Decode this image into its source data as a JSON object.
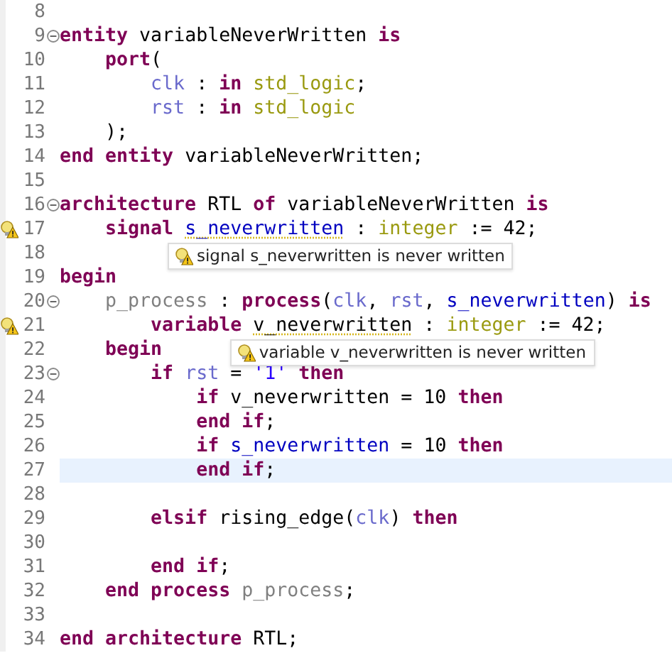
{
  "lines": [
    {
      "number": "8",
      "fold": false,
      "warning": false,
      "current": false
    },
    {
      "number": "9",
      "fold": true,
      "warning": false,
      "current": false,
      "tokens": [
        {
          "kind": "kw",
          "text": "entity"
        },
        {
          "kind": "plain",
          "text": " variableNeverWritten "
        },
        {
          "kind": "kw",
          "text": "is"
        }
      ]
    },
    {
      "number": "10",
      "fold": false,
      "warning": false,
      "current": false,
      "tokens": [
        {
          "kind": "kw",
          "text": "    port"
        },
        {
          "kind": "plain",
          "text": "("
        }
      ]
    },
    {
      "number": "11",
      "fold": false,
      "warning": false,
      "current": false,
      "tokens": [
        {
          "kind": "port",
          "text": "        clk"
        },
        {
          "kind": "plain",
          "text": " : "
        },
        {
          "kind": "kw",
          "text": "in"
        },
        {
          "kind": "type",
          "text": " std_logic"
        },
        {
          "kind": "plain",
          "text": ";"
        }
      ]
    },
    {
      "number": "12",
      "fold": false,
      "warning": false,
      "current": false,
      "tokens": [
        {
          "kind": "port",
          "text": "        rst"
        },
        {
          "kind": "plain",
          "text": " : "
        },
        {
          "kind": "kw",
          "text": "in"
        },
        {
          "kind": "type",
          "text": " std_logic"
        }
      ]
    },
    {
      "number": "13",
      "fold": false,
      "warning": false,
      "current": false,
      "tokens": [
        {
          "kind": "plain",
          "text": "    );"
        }
      ]
    },
    {
      "number": "14",
      "fold": false,
      "warning": false,
      "current": false,
      "tokens": [
        {
          "kind": "kw",
          "text": "end entity"
        },
        {
          "kind": "plain",
          "text": " variableNeverWritten;"
        }
      ]
    },
    {
      "number": "15",
      "fold": false,
      "warning": false,
      "current": false
    },
    {
      "number": "16",
      "fold": true,
      "warning": false,
      "current": false,
      "tokens": [
        {
          "kind": "kw",
          "text": "architecture"
        },
        {
          "kind": "plain",
          "text": " RTL "
        },
        {
          "kind": "kw",
          "text": "of"
        },
        {
          "kind": "plain",
          "text": " variableNeverWritten "
        },
        {
          "kind": "kw",
          "text": "is"
        }
      ]
    },
    {
      "number": "17",
      "fold": false,
      "warning": true,
      "current": false,
      "tooltip": "signal s_neverwritten is never written",
      "tokens": [
        {
          "kind": "kw",
          "text": "    signal "
        },
        {
          "kind": "sig",
          "text": "s_neverwritten",
          "underline": true
        },
        {
          "kind": "plain",
          "text": " : "
        },
        {
          "kind": "type",
          "text": "integer"
        },
        {
          "kind": "plain",
          "text": " := 42;"
        }
      ]
    },
    {
      "number": "18",
      "fold": false,
      "warning": false,
      "current": false
    },
    {
      "number": "19",
      "fold": false,
      "warning": false,
      "current": false,
      "tokens": [
        {
          "kind": "kw",
          "text": "begin"
        }
      ]
    },
    {
      "number": "20",
      "fold": true,
      "warning": false,
      "current": false,
      "tokens": [
        {
          "kind": "label",
          "text": "    p_process"
        },
        {
          "kind": "plain",
          "text": " : "
        },
        {
          "kind": "kw",
          "text": "process"
        },
        {
          "kind": "plain",
          "text": "("
        },
        {
          "kind": "port",
          "text": "clk"
        },
        {
          "kind": "plain",
          "text": ", "
        },
        {
          "kind": "port",
          "text": "rst"
        },
        {
          "kind": "plain",
          "text": ", "
        },
        {
          "kind": "sig",
          "text": "s_neverwritten"
        },
        {
          "kind": "plain",
          "text": ") "
        },
        {
          "kind": "kw",
          "text": "is"
        }
      ]
    },
    {
      "number": "21",
      "fold": false,
      "warning": true,
      "current": false,
      "tooltip": "variable v_neverwritten is never written",
      "tokens": [
        {
          "kind": "kw",
          "text": "        variable "
        },
        {
          "kind": "plain",
          "text": "v_neverwritten",
          "underline": true
        },
        {
          "kind": "plain",
          "text": " : "
        },
        {
          "kind": "type",
          "text": "integer"
        },
        {
          "kind": "plain",
          "text": " := 42;"
        }
      ]
    },
    {
      "number": "22",
      "fold": false,
      "warning": false,
      "current": false,
      "tokens": [
        {
          "kind": "kw",
          "text": "    begin"
        }
      ]
    },
    {
      "number": "23",
      "fold": true,
      "warning": false,
      "current": false,
      "tokens": [
        {
          "kind": "kw",
          "text": "        if"
        },
        {
          "kind": "port",
          "text": " rst"
        },
        {
          "kind": "plain",
          "text": " = "
        },
        {
          "kind": "str",
          "text": "'1'"
        },
        {
          "kind": "kw",
          "text": " then"
        }
      ]
    },
    {
      "number": "24",
      "fold": false,
      "warning": false,
      "current": false,
      "tokens": [
        {
          "kind": "kw",
          "text": "            if"
        },
        {
          "kind": "plain",
          "text": " v_neverwritten = 10 "
        },
        {
          "kind": "kw",
          "text": "then"
        }
      ]
    },
    {
      "number": "25",
      "fold": false,
      "warning": false,
      "current": false,
      "tokens": [
        {
          "kind": "kw",
          "text": "            end if"
        },
        {
          "kind": "plain",
          "text": ";"
        }
      ]
    },
    {
      "number": "26",
      "fold": false,
      "warning": false,
      "current": false,
      "tokens": [
        {
          "kind": "kw",
          "text": "            if"
        },
        {
          "kind": "sig",
          "text": " s_neverwritten"
        },
        {
          "kind": "plain",
          "text": " = 10 "
        },
        {
          "kind": "kw",
          "text": "then"
        }
      ]
    },
    {
      "number": "27",
      "fold": false,
      "warning": false,
      "current": true,
      "tokens": [
        {
          "kind": "kw",
          "text": "            end if"
        },
        {
          "kind": "plain",
          "text": ";"
        }
      ]
    },
    {
      "number": "28",
      "fold": false,
      "warning": false,
      "current": false
    },
    {
      "number": "29",
      "fold": false,
      "warning": false,
      "current": false,
      "tokens": [
        {
          "kind": "kw",
          "text": "        elsif"
        },
        {
          "kind": "plain",
          "text": " rising_edge("
        },
        {
          "kind": "port",
          "text": "clk"
        },
        {
          "kind": "plain",
          "text": ") "
        },
        {
          "kind": "kw",
          "text": "then"
        }
      ]
    },
    {
      "number": "30",
      "fold": false,
      "warning": false,
      "current": false
    },
    {
      "number": "31",
      "fold": false,
      "warning": false,
      "current": false,
      "tokens": [
        {
          "kind": "kw",
          "text": "        end if"
        },
        {
          "kind": "plain",
          "text": ";"
        }
      ]
    },
    {
      "number": "32",
      "fold": false,
      "warning": false,
      "current": false,
      "tokens": [
        {
          "kind": "kw",
          "text": "    end process"
        },
        {
          "kind": "label",
          "text": " p_process"
        },
        {
          "kind": "plain",
          "text": ";"
        }
      ]
    },
    {
      "number": "33",
      "fold": false,
      "warning": false,
      "current": false
    },
    {
      "number": "34",
      "fold": false,
      "warning": false,
      "current": false,
      "tokens": [
        {
          "kind": "kw",
          "text": "end architecture"
        },
        {
          "kind": "plain",
          "text": " RTL;"
        }
      ]
    }
  ]
}
